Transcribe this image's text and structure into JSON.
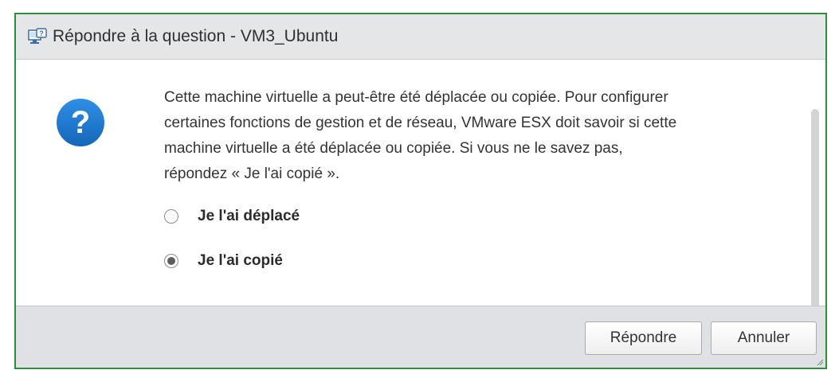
{
  "dialog": {
    "title": "Répondre à la question - VM3_Ubuntu",
    "title_icon": "vm-question-icon",
    "message_lines": [
      "Cette machine virtuelle a peut-être été déplacée ou copiée. Pour configurer",
      "certaines fonctions de gestion et de réseau, VMware ESX doit savoir si cette",
      "machine virtuelle a été déplacée ou copiée. Si vous ne le savez pas,",
      "répondez « Je l'ai copié »."
    ],
    "options": [
      {
        "label": "Je l'ai déplacé",
        "selected": false
      },
      {
        "label": "Je l'ai copié",
        "selected": true
      }
    ],
    "buttons": {
      "answer": "Répondre",
      "cancel": "Annuler"
    },
    "colors": {
      "accent_border": "#2d8f3c",
      "question_icon": "#1a73c9"
    }
  }
}
